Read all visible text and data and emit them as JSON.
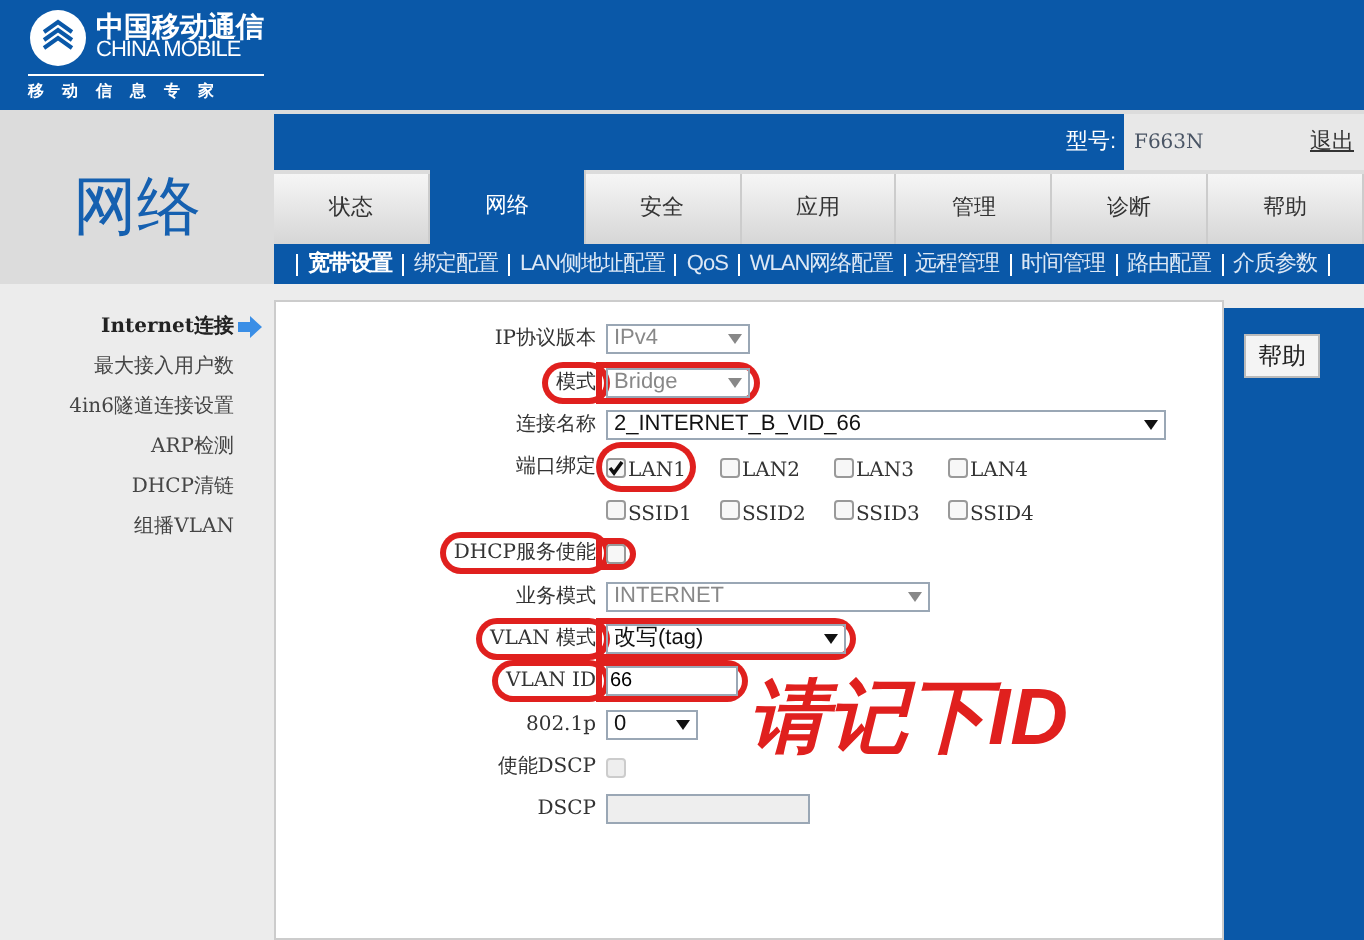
{
  "logo": {
    "cn": "中国移动通信",
    "en": "CHINA MOBILE",
    "slogan": "移动信息专家"
  },
  "model": {
    "label": "型号:",
    "value": "F663N"
  },
  "logout": "退出",
  "page_title": "网络",
  "tabs": [
    {
      "label": "状态",
      "selected": false
    },
    {
      "label": "网络",
      "selected": true
    },
    {
      "label": "安全",
      "selected": false
    },
    {
      "label": "应用",
      "selected": false
    },
    {
      "label": "管理",
      "selected": false
    },
    {
      "label": "诊断",
      "selected": false
    },
    {
      "label": "帮助",
      "selected": false
    }
  ],
  "subnav": [
    {
      "label": "宽带设置",
      "selected": true
    },
    {
      "label": "绑定配置",
      "selected": false
    },
    {
      "label": "LAN侧地址配置",
      "selected": false
    },
    {
      "label": "QoS",
      "selected": false
    },
    {
      "label": "WLAN网络配置",
      "selected": false
    },
    {
      "label": "远程管理",
      "selected": false
    },
    {
      "label": "时间管理",
      "selected": false
    },
    {
      "label": "路由配置",
      "selected": false
    },
    {
      "label": "介质参数",
      "selected": false
    }
  ],
  "sidebar": [
    {
      "label": "Internet连接",
      "selected": true
    },
    {
      "label": "最大接入用户数",
      "selected": false
    },
    {
      "label": "4in6隧道连接设置",
      "selected": false
    },
    {
      "label": "ARP检测",
      "selected": false
    },
    {
      "label": "DHCP清链",
      "selected": false
    },
    {
      "label": "组播VLAN",
      "selected": false
    }
  ],
  "form": [
    {
      "kind": "select",
      "label": "IP协议版本",
      "value": "IPv4",
      "disabled": true,
      "highlighted": false
    },
    {
      "kind": "select",
      "label": "模式",
      "value": "Bridge",
      "disabled": true,
      "highlighted": true
    },
    {
      "kind": "select",
      "label": "连接名称",
      "value": "2_INTERNET_B_VID_66",
      "disabled": false,
      "highlighted": false
    },
    {
      "kind": "checkgroup",
      "label": "端口绑定",
      "highlighted": false,
      "options": [
        {
          "label": "LAN1",
          "checked": true,
          "highlighted": true
        },
        {
          "label": "LAN2",
          "checked": false,
          "highlighted": false
        },
        {
          "label": "LAN3",
          "checked": false,
          "highlighted": false
        },
        {
          "label": "LAN4",
          "checked": false,
          "highlighted": false
        }
      ]
    },
    {
      "kind": "checkgroup",
      "highlighted": false,
      "options": [
        {
          "label": "SSID1",
          "checked": false,
          "highlighted": false
        },
        {
          "label": "SSID2",
          "checked": false,
          "highlighted": false
        },
        {
          "label": "SSID3",
          "checked": false,
          "highlighted": false
        },
        {
          "label": "SSID4",
          "checked": false,
          "highlighted": false
        }
      ]
    },
    {
      "kind": "checkbox",
      "label": "DHCP服务使能",
      "checked": false,
      "disabled": false,
      "highlighted": true
    },
    {
      "kind": "select",
      "label": "业务模式",
      "value": "INTERNET",
      "disabled": true,
      "highlighted": false
    },
    {
      "kind": "select",
      "label": "VLAN 模式",
      "value": "改写(tag)",
      "disabled": false,
      "highlighted": true
    },
    {
      "kind": "text",
      "label": "VLAN ID",
      "value": "66",
      "disabled": false,
      "highlighted": true
    },
    {
      "kind": "select",
      "label": "802.1p",
      "value": "0",
      "disabled": false,
      "highlighted": false
    },
    {
      "kind": "checkbox",
      "label": "使能DSCP",
      "checked": false,
      "disabled": true,
      "highlighted": false
    },
    {
      "kind": "text",
      "label": "DSCP",
      "disabled": true,
      "highlighted": false
    }
  ],
  "help_button": "帮助",
  "handwritten_note": "请记下ID"
}
